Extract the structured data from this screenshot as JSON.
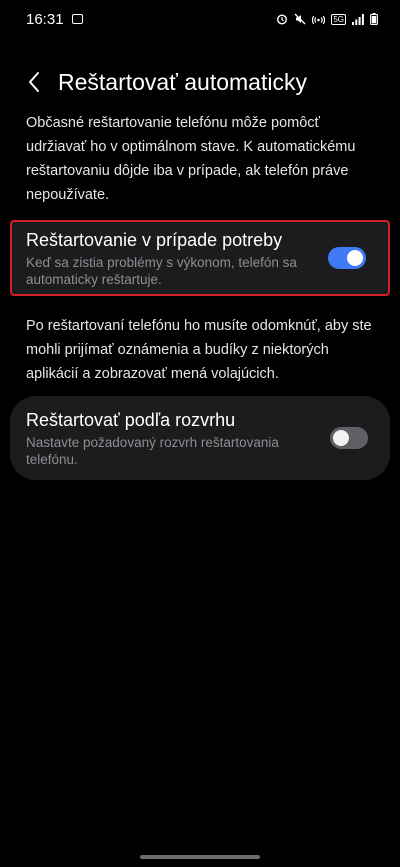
{
  "status_bar": {
    "time": "16:31",
    "network": "5G",
    "icons": [
      "image-icon",
      "alarm-icon",
      "mute-icon",
      "hotspot-icon",
      "signal-icon",
      "battery-icon"
    ]
  },
  "header": {
    "title": "Reštartovať automaticky"
  },
  "description_top": "Občasné reštartovanie telefónu môže pomôcť udržiavať ho v optimálnom stave. K automatickému reštartovaniu dôjde iba v prípade, ak telefón práve nepoužívate.",
  "option_restart_when_needed": {
    "title": "Reštartovanie v prípade potreby",
    "subtitle": "Keď sa zistia problémy s výkonom, telefón sa automaticky reštartuje.",
    "enabled": true
  },
  "description_mid": "Po reštartovaní telefónu ho musíte odomknúť, aby ste mohli prijímať oznámenia a budíky z niektorých aplikácií a zobrazovať mená volajúcich.",
  "option_scheduled_restart": {
    "title": "Reštartovať podľa rozvrhu",
    "subtitle": "Nastavte požadovaný rozvrh reštartovania telefónu.",
    "enabled": false
  },
  "colors": {
    "accent": "#3e7bf5",
    "highlight_border": "#d21f28",
    "card_background": "#1c1c1e"
  }
}
